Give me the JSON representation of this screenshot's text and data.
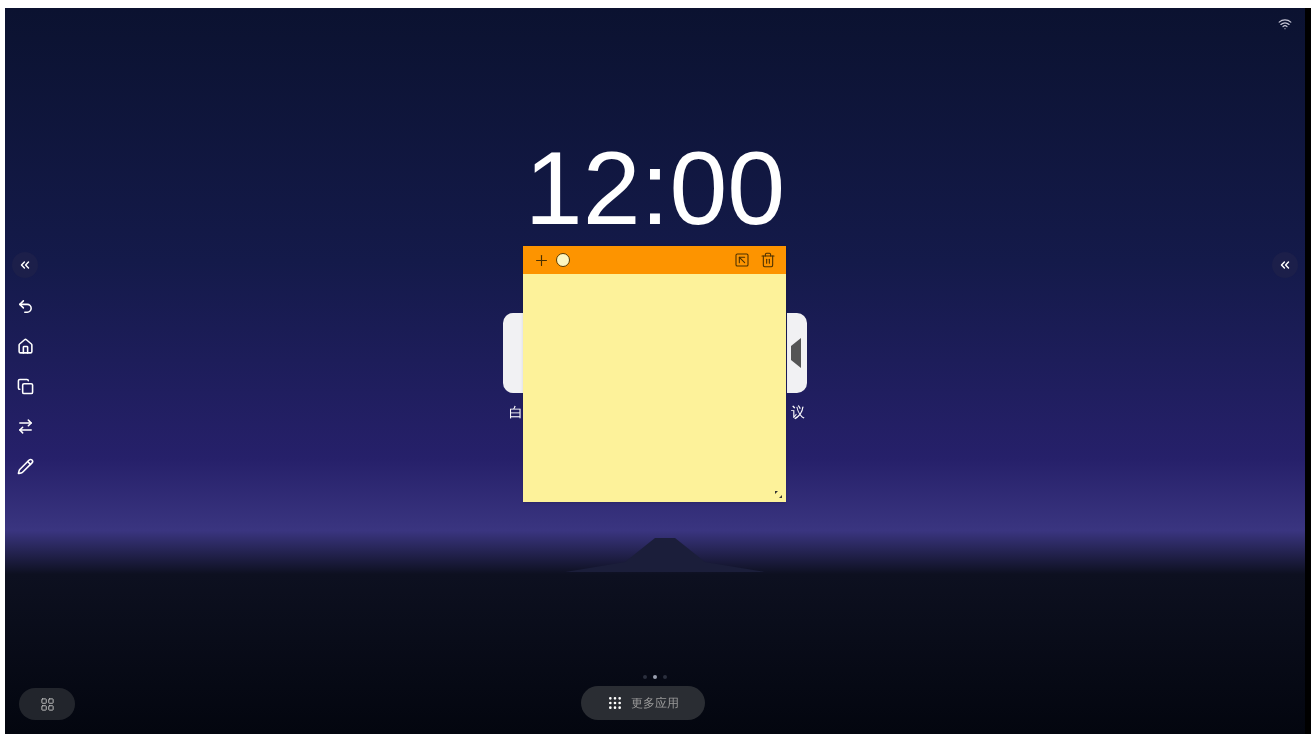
{
  "clock": "12:00",
  "apps": [
    {
      "label": "白",
      "kind": "whiteboard"
    },
    {
      "label": "议",
      "kind": "meeting"
    }
  ],
  "page_dots": [
    {
      "selected": false
    },
    {
      "selected": true
    },
    {
      "selected": false
    }
  ],
  "more_apps": {
    "label": "更多应用"
  }
}
